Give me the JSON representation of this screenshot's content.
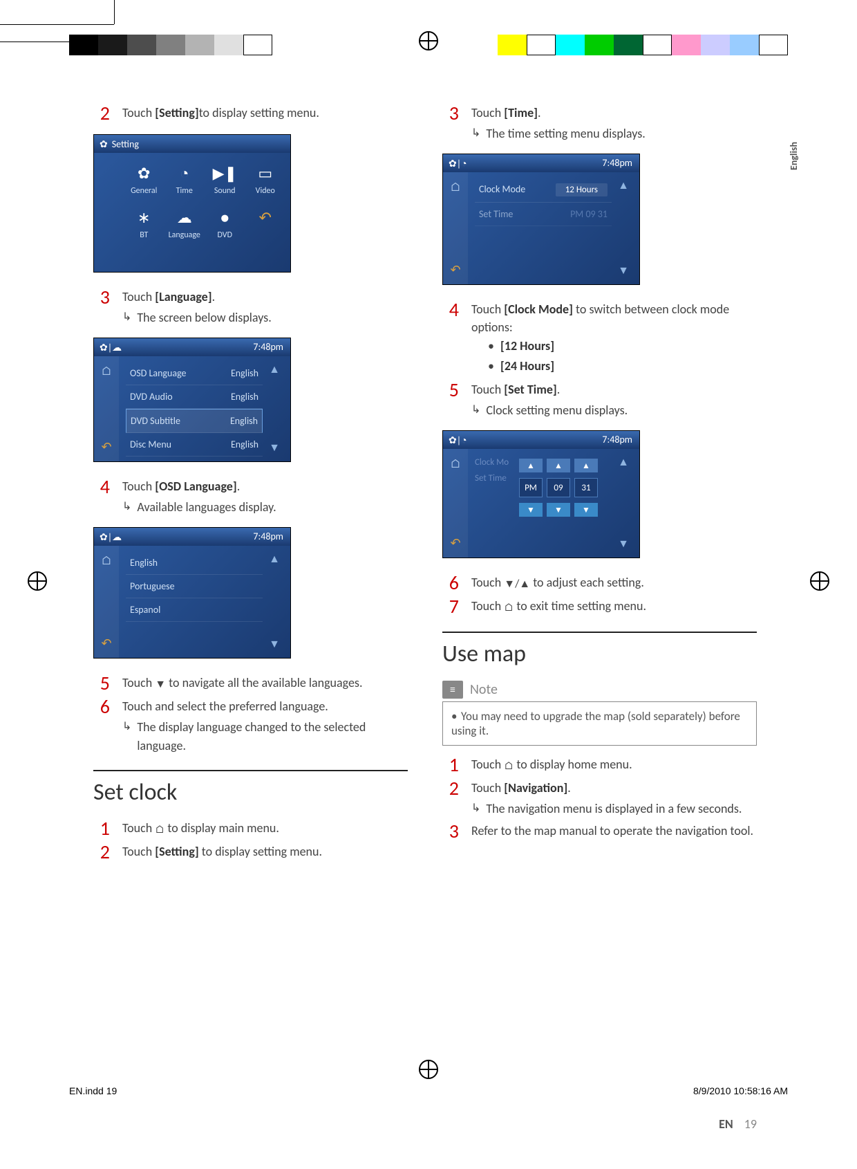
{
  "lang_tab": "English",
  "left": {
    "step2": {
      "pre": "Touch ",
      "bold": "[Setting]",
      "post": "to display setting menu."
    },
    "shot1": {
      "title": "Setting",
      "icons": [
        "General",
        "Time",
        "Sound",
        "Video",
        "BT",
        "Language",
        "DVD"
      ],
      "back_icon": "↶"
    },
    "step3": {
      "pre": "Touch ",
      "bold": "[Language]",
      "post": ".",
      "sub": "The screen below displays."
    },
    "shot2": {
      "time": "7:48pm",
      "rows": [
        {
          "label": "OSD Language",
          "val": "English"
        },
        {
          "label": "DVD Audio",
          "val": "English"
        },
        {
          "label": "DVD Subtitle",
          "val": "English",
          "sel": true
        },
        {
          "label": "Disc Menu",
          "val": "English"
        }
      ]
    },
    "step4": {
      "pre": "Touch ",
      "bold": "[OSD Language]",
      "post": ".",
      "sub": "Available languages display."
    },
    "shot3": {
      "time": "7:48pm",
      "items": [
        "English",
        "Portuguese",
        "Espanol"
      ]
    },
    "step5": {
      "pre": "Touch ",
      "icon": "▼",
      "post": " to navigate all the available languages."
    },
    "step6": {
      "text": "Touch and select the preferred language.",
      "sub": "The display language changed to the selected language."
    },
    "section": "Set clock",
    "sc_step1": {
      "pre": "Touch ",
      "icon": "⌂",
      "post": " to display main menu."
    },
    "sc_step2": {
      "pre": "Touch ",
      "bold": "[Setting]",
      "post": " to display setting menu."
    }
  },
  "right": {
    "step3": {
      "pre": "Touch ",
      "bold": "[Time]",
      "post": ".",
      "sub": "The time setting menu displays."
    },
    "shot4": {
      "time": "7:48pm",
      "rows": [
        {
          "label": "Clock Mode",
          "val": "12 Hours"
        },
        {
          "label": "Set Time",
          "val": "PM  09  31",
          "dim": true
        }
      ]
    },
    "step4": {
      "pre": "Touch ",
      "bold": "[Clock Mode]",
      "post": " to switch between clock mode options:",
      "opts": [
        "[12 Hours]",
        "[24 Hours]"
      ]
    },
    "step5": {
      "pre": "Touch ",
      "bold": "[Set Time]",
      "post": ".",
      "sub": "Clock setting menu displays."
    },
    "shot5": {
      "time": "7:48pm",
      "dimrows": [
        "Clock Mo",
        "Set Time"
      ],
      "cells": [
        "PM",
        "09",
        "31"
      ]
    },
    "step6": {
      "pre": "Touch ",
      "icons": "▼/▲",
      "post": " to adjust each setting."
    },
    "step7": {
      "pre": "Touch ",
      "icon": "⌂",
      "post": " to exit time setting menu."
    },
    "section": "Use map",
    "note_title": "Note",
    "note_body": "You may need to upgrade the map (sold separately) before using it.",
    "um_step1": {
      "pre": "Touch ",
      "icon": "⌂",
      "post": " to display home menu."
    },
    "um_step2": {
      "pre": "Touch ",
      "bold": "[Navigation]",
      "post": ".",
      "sub": "The navigation menu is displayed in a few seconds."
    },
    "um_step3": {
      "text": "Refer to the map manual to operate the navigation tool."
    }
  },
  "footer": {
    "lang": "EN",
    "page": "19"
  },
  "slug": {
    "file": "EN.indd   19",
    "stamp": "8/9/2010   10:58:16 AM"
  }
}
